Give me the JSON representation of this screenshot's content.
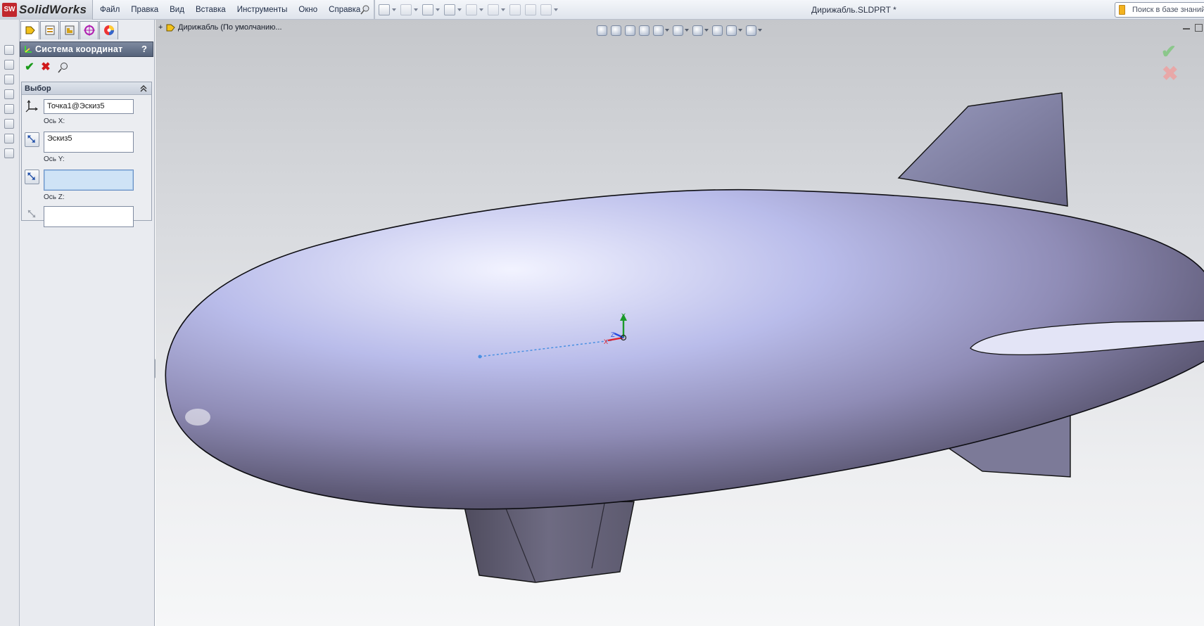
{
  "app": {
    "brand_logo": "SW",
    "brand_name": "SolidWorks",
    "document_title": "Дирижабль.SLDPRT *"
  },
  "menu": {
    "items": [
      "Файл",
      "Правка",
      "Вид",
      "Вставка",
      "Инструменты",
      "Окно",
      "Справка"
    ]
  },
  "search": {
    "placeholder": "Поиск в базе знаний"
  },
  "feature_tree": {
    "expand_symbol": "+",
    "root_label": "Дирижабль  (По умолчанию..."
  },
  "property_manager": {
    "title": "Система координат",
    "help": "?",
    "ok_symbol": "✔",
    "cancel_symbol": "✖",
    "group": {
      "title": "Выбор",
      "origin_value": "Точка1@Эскиз5",
      "x_axis_label": "Ось X:",
      "x_axis_value": "Эскиз5",
      "y_axis_label": "Ось Y:",
      "y_axis_value": "",
      "z_axis_label": "Ось Z:",
      "z_axis_value": ""
    }
  },
  "viewport": {
    "ok_symbol": "✔",
    "cancel_symbol": "✖",
    "triad_labels": {
      "x": "X",
      "y": "Y",
      "z": "Z"
    }
  },
  "colors": {
    "accent_header": "#55627a",
    "active_field": "#cfe3f6",
    "model_body": "#a6a7cf",
    "triad_x": "#e0202a",
    "triad_y": "#1b9a2a",
    "triad_z": "#2a4de0"
  }
}
